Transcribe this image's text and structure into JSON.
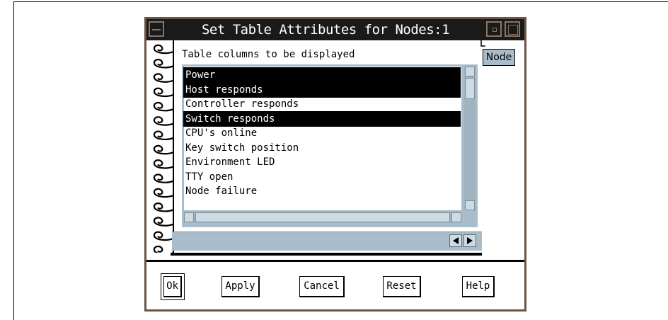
{
  "window": {
    "title": "Set Table Attributes for Nodes:1"
  },
  "notebook": {
    "tab_label": "Node",
    "columns_label": "Table columns to be displayed",
    "items": [
      {
        "label": "Power",
        "selected": true
      },
      {
        "label": "Host responds",
        "selected": true
      },
      {
        "label": "Controller responds",
        "selected": false
      },
      {
        "label": "Switch responds",
        "selected": true
      },
      {
        "label": "CPU's online",
        "selected": false
      },
      {
        "label": "Key switch position",
        "selected": false
      },
      {
        "label": "Environment LED",
        "selected": false
      },
      {
        "label": "TTY open",
        "selected": false
      },
      {
        "label": "Node failure",
        "selected": false
      }
    ]
  },
  "buttons": {
    "ok": "Ok",
    "apply": "Apply",
    "cancel": "Cancel",
    "reset": "Reset",
    "help": "Help"
  },
  "colors": {
    "frame": "#6a5546",
    "panel": "#a9bcc9",
    "titlebar": "#1a1a1a"
  }
}
